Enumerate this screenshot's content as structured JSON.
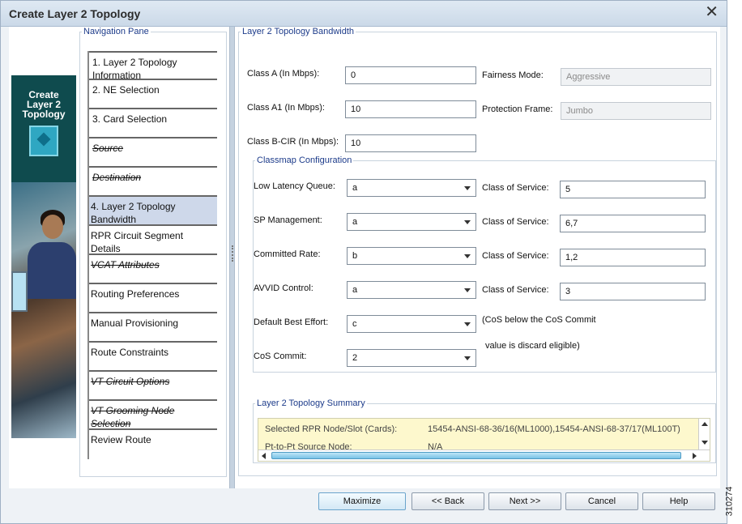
{
  "window": {
    "title": "Create Layer 2 Topology",
    "close_glyph": "✕"
  },
  "banner": {
    "title_line1": "Create",
    "title_line2": "Layer 2",
    "title_line3": "Topology"
  },
  "nav": {
    "legend": "Navigation Pane",
    "items": [
      {
        "label": "1. Layer 2 Topology Information"
      },
      {
        "label": "2. NE Selection"
      },
      {
        "label": "3. Card Selection"
      },
      {
        "label": "Source"
      },
      {
        "label": "Destination"
      },
      {
        "label": "4. Layer 2 Topology Bandwidth"
      },
      {
        "label": "RPR Circuit Segment Details"
      },
      {
        "label": "VCAT Attributes"
      },
      {
        "label": "Routing Preferences"
      },
      {
        "label": "Manual Provisioning"
      },
      {
        "label": "Route Constraints"
      },
      {
        "label": "VT Circuit Options"
      },
      {
        "label": "VT Grooming Node Selection"
      },
      {
        "label": "Review Route"
      }
    ]
  },
  "bandwidth": {
    "legend": "Layer 2 Topology Bandwidth",
    "class_a_label": "Class A (In Mbps):",
    "class_a_value": "0",
    "class_a1_label": "Class A1 (In Mbps):",
    "class_a1_value": "10",
    "class_bcir_label": "Class B-CIR (In Mbps):",
    "class_bcir_value": "10",
    "fairness_label": "Fairness Mode:",
    "fairness_value": "Aggressive",
    "protection_label": "Protection Frame:",
    "protection_value": "Jumbo"
  },
  "classmap": {
    "legend": "Classmap Configuration",
    "rows": [
      {
        "label": "Low Latency Queue:",
        "select": "a",
        "cos_label": "Class of Service:",
        "cos_value": "5"
      },
      {
        "label": "SP Management:",
        "select": "a",
        "cos_label": "Class of Service:",
        "cos_value": "6,7"
      },
      {
        "label": "Committed Rate:",
        "select": "b",
        "cos_label": "Class of Service:",
        "cos_value": "1,2"
      },
      {
        "label": "AVVID Control:",
        "select": "a",
        "cos_label": "Class of Service:",
        "cos_value": "3"
      }
    ],
    "best_effort_label": "Default Best Effort:",
    "best_effort_value": "c",
    "cos_commit_label": "CoS Commit:",
    "cos_commit_value": "2",
    "note_line1": "(CoS below the CoS Commit",
    "note_line2": "value is discard eligible)"
  },
  "summary": {
    "legend": "Layer 2 Topology Summary",
    "row1_label": "Selected RPR Node/Slot (Cards):",
    "row1_value": "15454-ANSI-68-36/16(ML1000),15454-ANSI-68-37/17(ML100T)",
    "row2_label": "Pt-to-Pt Source Node:",
    "row2_value": "N/A"
  },
  "buttons": {
    "maximize": "Maximize",
    "back": "<< Back",
    "next": "Next >>",
    "cancel": "Cancel",
    "help": "Help"
  },
  "figure_code": "310274"
}
